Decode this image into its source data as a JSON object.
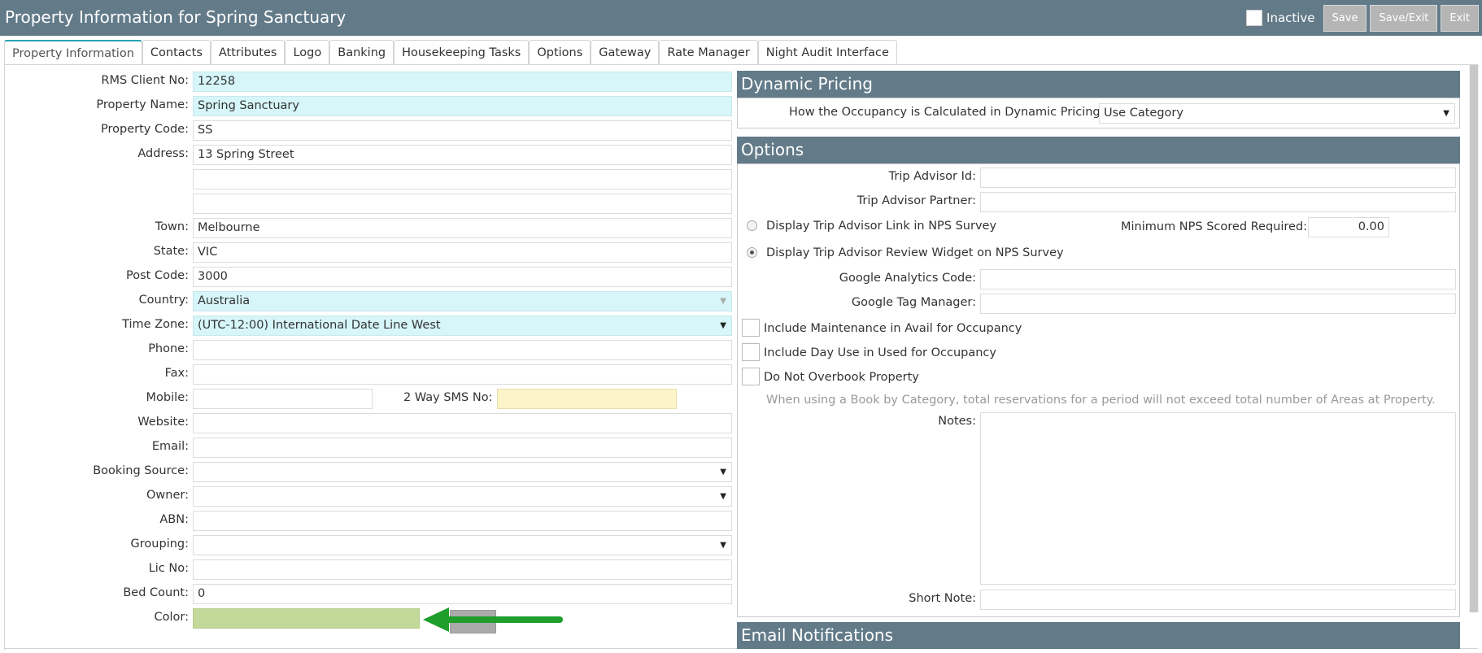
{
  "window": {
    "title": "Property Information for Spring Sanctuary",
    "inactive_label": "Inactive",
    "save_label": "Save",
    "save_exit_label": "Save/Exit",
    "exit_label": "Exit"
  },
  "tabs": [
    {
      "label": "Property Information",
      "active": true
    },
    {
      "label": "Contacts"
    },
    {
      "label": "Attributes"
    },
    {
      "label": "Logo"
    },
    {
      "label": "Banking"
    },
    {
      "label": "Housekeeping Tasks"
    },
    {
      "label": "Options"
    },
    {
      "label": "Gateway"
    },
    {
      "label": "Rate Manager"
    },
    {
      "label": "Night Audit Interface"
    }
  ],
  "form": {
    "rms_client_no": {
      "label": "RMS Client No:",
      "value": "12258"
    },
    "property_name": {
      "label": "Property Name:",
      "value": "Spring Sanctuary"
    },
    "property_code": {
      "label": "Property Code:",
      "value": "SS"
    },
    "address": {
      "label": "Address:",
      "line1": "13 Spring Street",
      "line2": "",
      "line3": ""
    },
    "town": {
      "label": "Town:",
      "value": "Melbourne"
    },
    "state": {
      "label": "State:",
      "value": "VIC"
    },
    "post_code": {
      "label": "Post Code:",
      "value": "3000"
    },
    "country": {
      "label": "Country:",
      "value": "Australia"
    },
    "time_zone": {
      "label": "Time Zone:",
      "value": "(UTC-12:00) International Date Line West"
    },
    "phone": {
      "label": "Phone:",
      "value": ""
    },
    "fax": {
      "label": "Fax:",
      "value": ""
    },
    "mobile": {
      "label": "Mobile:",
      "value": ""
    },
    "two_way_sms": {
      "label": "2 Way SMS No:",
      "value": ""
    },
    "website": {
      "label": "Website:",
      "value": ""
    },
    "email": {
      "label": "Email:",
      "value": ""
    },
    "booking_source": {
      "label": "Booking Source:",
      "value": ""
    },
    "owner": {
      "label": "Owner:",
      "value": ""
    },
    "abn": {
      "label": "ABN:",
      "value": ""
    },
    "grouping": {
      "label": "Grouping:",
      "value": ""
    },
    "lic_no": {
      "label": "Lic No:",
      "value": ""
    },
    "bed_count": {
      "label": "Bed Count:",
      "value": "0"
    },
    "color": {
      "label": "Color:",
      "value": "",
      "swatch": "#c3d99a"
    }
  },
  "dynamic_pricing": {
    "header": "Dynamic Pricing",
    "occupancy_label": "How the Occupancy is Calculated in Dynamic Pricing:",
    "occupancy_value": "Use Category"
  },
  "options": {
    "header": "Options",
    "trip_advisor_id": {
      "label": "Trip Advisor Id:",
      "value": ""
    },
    "trip_advisor_partner": {
      "label": "Trip Advisor Partner:",
      "value": ""
    },
    "radio_link": {
      "label": "Display Trip Advisor Link in NPS Survey",
      "selected": false
    },
    "radio_widget": {
      "label": "Display Trip Advisor Review Widget on NPS Survey",
      "selected": true
    },
    "min_nps": {
      "label": "Minimum NPS Scored Required:",
      "value": "0.00"
    },
    "google_analytics": {
      "label": "Google Analytics Code:",
      "value": ""
    },
    "google_tag_manager": {
      "label": "Google Tag Manager:",
      "value": ""
    },
    "include_maintenance": {
      "label": "Include Maintenance in Avail for Occupancy",
      "checked": false
    },
    "include_day_use": {
      "label": "Include Day Use in Used for Occupancy",
      "checked": false
    },
    "do_not_overbook": {
      "label": "Do Not Overbook Property",
      "checked": false
    },
    "overbook_help": "When using a Book by Category, total reservations for a period will not exceed total number of Areas at Property.",
    "notes": {
      "label": "Notes:",
      "value": ""
    },
    "short_note": {
      "label": "Short Note:",
      "value": ""
    }
  },
  "email_notifications": {
    "header": "Email Notifications"
  },
  "colors": {
    "header_bg": "#637b89",
    "cyan_field": "#d6f6f9",
    "yellow_field": "#fdf5c9",
    "arrow": "#1f9e2c"
  }
}
